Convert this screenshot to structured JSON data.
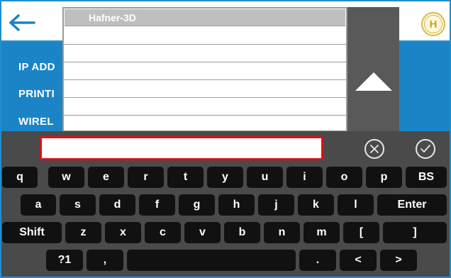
{
  "header": {
    "back_icon": "arrow-left-icon",
    "logo_letter": "H"
  },
  "settings": {
    "labels": [
      "IP ADD",
      "PRINTI",
      "WIREL"
    ]
  },
  "dropdown": {
    "items": [
      "Hafner-3D",
      "",
      "",
      "",
      "",
      "",
      ""
    ],
    "selected_index": 0
  },
  "input": {
    "value": "",
    "placeholder": ""
  },
  "keyboard": {
    "row1": [
      "q",
      "w",
      "e",
      "r",
      "t",
      "y",
      "u",
      "i",
      "o",
      "p",
      "BS"
    ],
    "row2": [
      "a",
      "s",
      "d",
      "f",
      "g",
      "h",
      "j",
      "k",
      "l",
      "Enter"
    ],
    "row3": [
      "Shift",
      "z",
      "x",
      "c",
      "v",
      "b",
      "n",
      "m",
      "[",
      "]"
    ],
    "row4": [
      "?1",
      ",",
      "",
      ".",
      "<",
      ">"
    ],
    "cancel_icon": "circle-x-icon",
    "confirm_icon": "circle-check-icon"
  },
  "colors": {
    "accent_blue": "#1b84c6",
    "highlight_red": "#e01010",
    "keyboard_bg": "#4a4a4a",
    "key_bg": "#111111"
  }
}
